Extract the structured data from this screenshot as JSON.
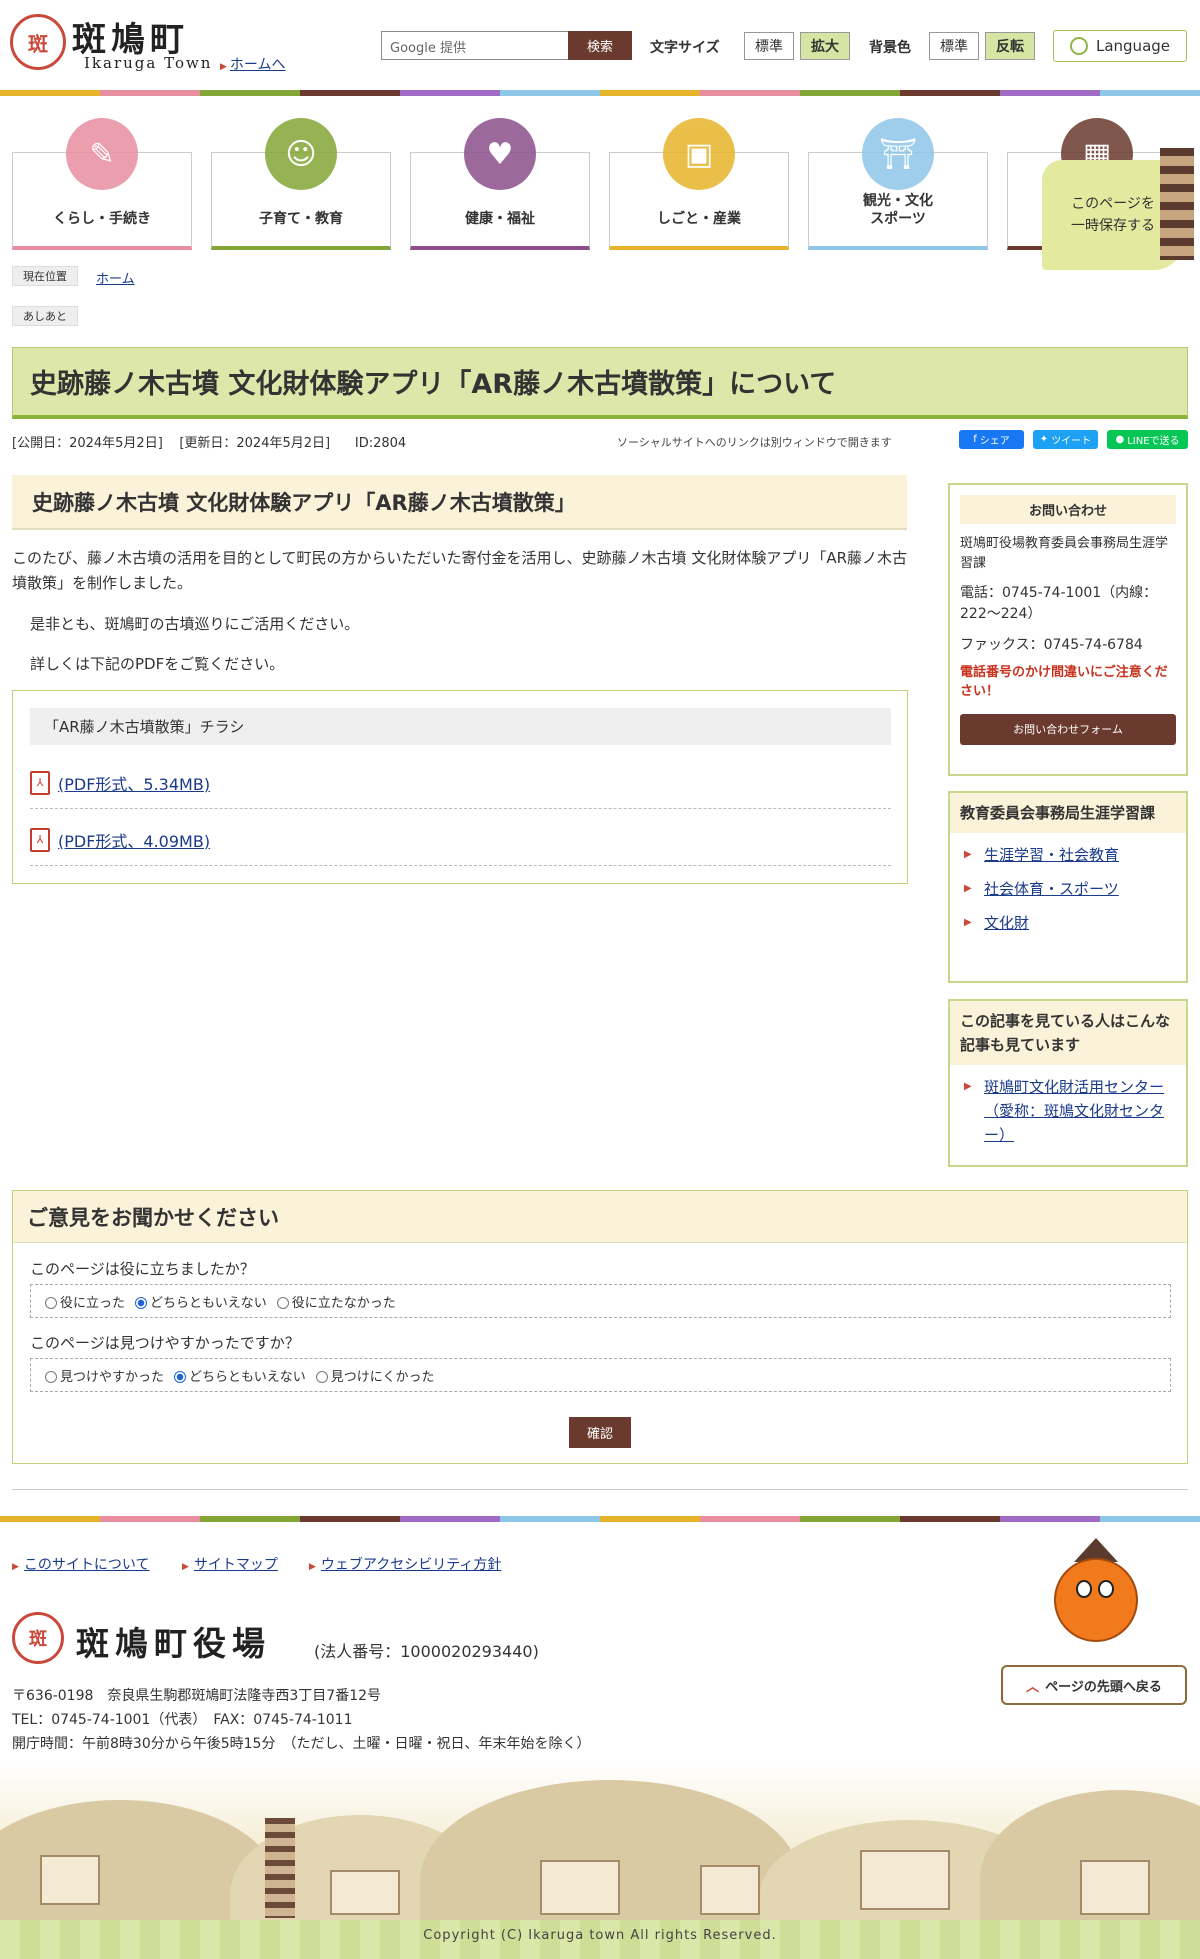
{
  "header": {
    "logo_mark": "斑",
    "site_title": "斑鳩町",
    "site_title_en": "Ikaruga Town",
    "home_link": "ホームへ",
    "search_placeholder": "Google 提供",
    "search_button": "検索",
    "font_size_label": "文字サイズ",
    "font_std": "標準",
    "font_large": "拡大",
    "bg_label": "背景色",
    "bg_std": "標準",
    "bg_invert": "反転",
    "language": "Language"
  },
  "stripe_colors": [
    "#e6b42b",
    "#e88ea0",
    "#84a636",
    "#6b3a2e",
    "#a06bc4",
    "#8ec6e8",
    "#e6b42b",
    "#e88ea0",
    "#84a636",
    "#6b3a2e",
    "#a06bc4",
    "#8ec6e8"
  ],
  "categories": [
    {
      "label": "くらし・手続き",
      "icon": "document-pen-icon",
      "color": "#e88ea0"
    },
    {
      "label": "子育て・教育",
      "icon": "baby-face-icon",
      "color": "#84a636"
    },
    {
      "label": "健康・福祉",
      "icon": "heart-pulse-icon",
      "color": "#8b4f8c"
    },
    {
      "label": "しごと・産業",
      "icon": "briefcase-icon",
      "color": "#e6b42b"
    },
    {
      "label": "観光・文化\nスポーツ",
      "icon": "pagoda-icon",
      "color": "#8ec6e8"
    },
    {
      "label": "",
      "icon": "building-icon",
      "color": "#6b3a2e"
    }
  ],
  "save_badge": "このページを\n一時保存する",
  "breadcrumb": {
    "current_label": "現在位置",
    "home": "ホーム",
    "trail_label": "あしあと"
  },
  "page": {
    "title": "史跡藤ノ木古墳 文化財体験アプリ「AR藤ノ木古墳散策」について",
    "published": "[公開日：2024年5月2日]",
    "updated": "[更新日：2024年5月2日]",
    "id": "ID:2804",
    "social_note": "ソーシャルサイトへのリンクは別ウィンドウで開きます",
    "share_fb": "シェア",
    "share_tw": "ツイート",
    "share_line": "LINEで送る"
  },
  "content": {
    "subtitle": "史跡藤ノ木古墳 文化財体験アプリ「AR藤ノ木古墳散策」",
    "para1": "このたび、藤ノ木古墳の活用を目的として町民の方からいただいた寄付金を活用し、史跡藤ノ木古墳 文化財体験アプリ「AR藤ノ木古墳散策」を制作しました。",
    "para2": "是非とも、斑鳩町の古墳巡りにご活用ください。",
    "para3": "詳しくは下記のPDFをご覧ください。",
    "pdf_heading": "「AR藤ノ木古墳散策」チラシ",
    "pdfs": [
      {
        "label": "(PDF形式、5.34MB)"
      },
      {
        "label": "(PDF形式、4.09MB)"
      }
    ]
  },
  "sidebar": {
    "contact_head": "お問い合わせ",
    "contact_dept": "斑鳩町役場教育委員会事務局生涯学習課",
    "contact_phone": "電話：0745-74-1001（内線：222～224）",
    "contact_fax": "ファックス：0745-74-6784",
    "contact_warning": "電話番号のかけ間違いにご注意ください！",
    "contact_form": "お問い合わせフォーム",
    "dept_head": "教育委員会事務局生涯学習課",
    "dept_links": [
      "生涯学習・社会教育",
      "社会体育・スポーツ",
      "文化財"
    ],
    "related_head": "この記事を見ている人はこんな記事も見ています",
    "related_links": [
      "斑鳩町文化財活用センター（愛称：斑鳩文化財センター）"
    ]
  },
  "feedback": {
    "title": "ご意見をお聞かせください",
    "q1": "このページは役に立ちましたか？",
    "q1_opts": [
      "役に立った",
      "どちらともいえない",
      "役に立たなかった"
    ],
    "q1_selected": 1,
    "q2": "このページは見つけやすかったですか？",
    "q2_opts": [
      "見つけやすかった",
      "どちらともいえない",
      "見つけにくかった"
    ],
    "q2_selected": 1,
    "confirm": "確認"
  },
  "footer": {
    "links": [
      "このサイトについて",
      "サイトマップ",
      "ウェブアクセシビリティ方針"
    ],
    "office": "斑鳩町役場",
    "corp_no": "(法人番号：1000020293440)",
    "address": "〒636-0198　奈良県生駒郡斑鳩町法隆寺西3丁目7番12号",
    "tel_fax": "TEL：0745-74-1001（代表）　FAX：0745-74-1011",
    "hours": "開庁時間：午前8時30分から午後5時15分　（ただし、土曜・日曜・祝日、年末年始を除く）",
    "pagetop": "ページの先頭へ戻る",
    "copyright": "Copyright (C) Ikaruga town All rights Reserved."
  }
}
